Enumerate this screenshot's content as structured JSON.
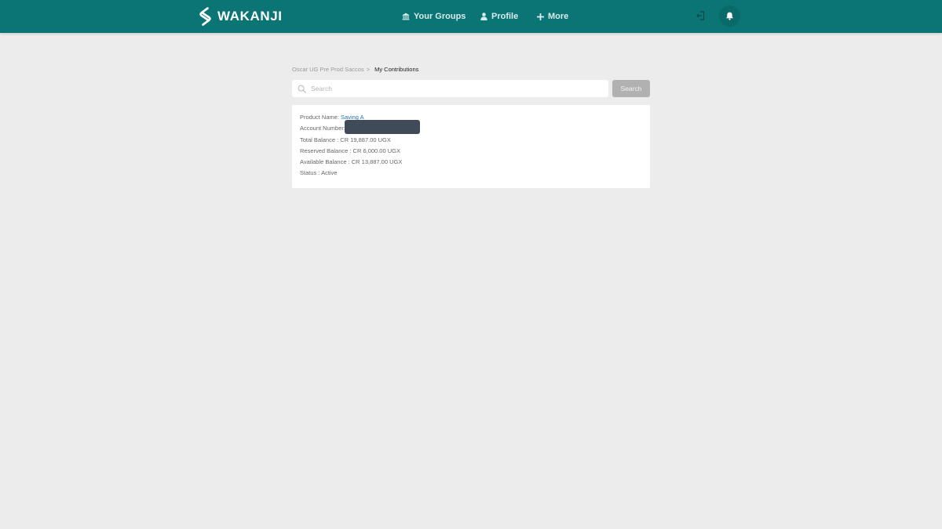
{
  "brand": {
    "name": "WAKANJI"
  },
  "nav": {
    "items": [
      {
        "label": "Your Groups",
        "icon": "bank-icon"
      },
      {
        "label": "Profile",
        "icon": "user-icon"
      },
      {
        "label": "More",
        "icon": "plus-icon"
      }
    ],
    "logout_icon": "logout-icon",
    "notifications_icon": "bell-icon"
  },
  "breadcrumb": {
    "parent": "Oscar UG Pre Prod Saccos",
    "separator": ">",
    "current": "My Contributions"
  },
  "search": {
    "placeholder": "Search",
    "value": "",
    "button_label": "Search"
  },
  "account": {
    "product_label": "Product Name:",
    "product_value": "Saving A",
    "account_number_label": "Account Number:",
    "account_number_value": "",
    "total_balance": "Total Balance : CR 19,887.00 UGX",
    "reserved_balance": "Reserved Balance : CR 6,000.00 UGX",
    "available_balance": "Available Balance : CR 13,887.00 UGX",
    "status": "Status : Active"
  },
  "colors": {
    "header": "#0b7575",
    "background": "#ececec",
    "link": "#1f72b3",
    "button": "#b1b1b1"
  }
}
